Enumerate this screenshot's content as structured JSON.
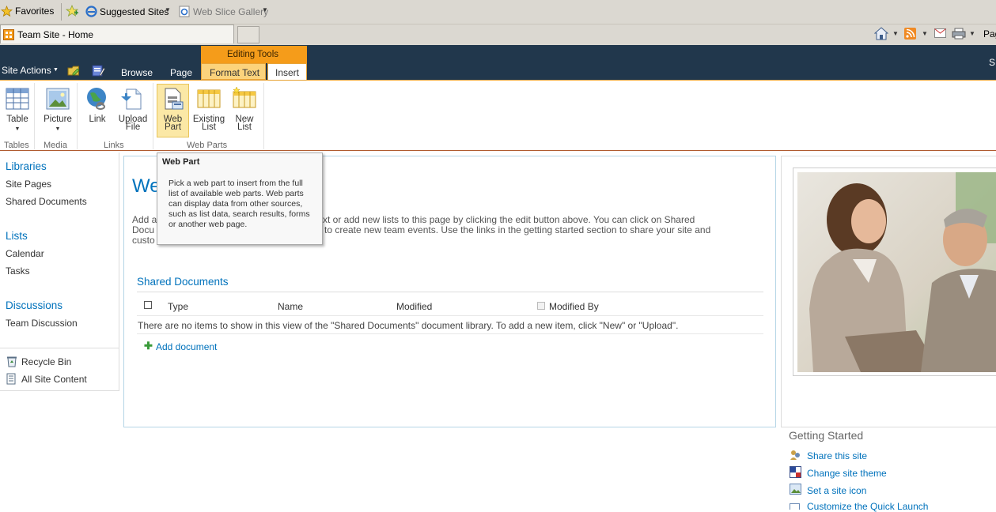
{
  "browser": {
    "favorites_label": "Favorites",
    "suggested_sites": "Suggested Sites",
    "web_slice_gallery": "Web Slice Gallery",
    "tab_title": "Team Site - Home",
    "page_menu": "Pag"
  },
  "sp_header": {
    "site_actions": "Site Actions",
    "tabs": [
      "Browse",
      "Page"
    ],
    "editing_tools": "Editing Tools",
    "format_text": "Format Text",
    "insert": "Insert",
    "right_letter": "S"
  },
  "ribbon": {
    "buttons": {
      "table": "Table",
      "picture": "Picture",
      "link": "Link",
      "upload_line1": "Upload",
      "upload_line2": "File",
      "webpart_line1": "Web",
      "webpart_line2": "Part",
      "existing_line1": "Existing",
      "existing_line2": "List",
      "new_line1": "New",
      "new_line2": "List"
    },
    "groups": [
      "Tables",
      "Media",
      "Links",
      "Web Parts"
    ]
  },
  "left_nav": {
    "libraries": "Libraries",
    "site_pages": "Site Pages",
    "shared_documents": "Shared Documents",
    "lists": "Lists",
    "calendar": "Calendar",
    "tasks": "Tasks",
    "discussions": "Discussions",
    "team_discussion": "Team Discussion",
    "recycle_bin": "Recycle Bin",
    "all_site_content": "All Site Content"
  },
  "main": {
    "title_partial": "We",
    "intro_line1_left": "Add a",
    "intro_line1_right": "xt or add new lists to this page by clicking the edit button above. You can click on Shared",
    "intro_line2_left": "Docu",
    "intro_line2_right": "to create new team events. Use the links in the getting started section to share your site and",
    "intro_line3_left": "custo",
    "shared_docs_title": "Shared Documents",
    "columns": [
      "Type",
      "Name",
      "Modified",
      "Modified By"
    ],
    "empty_message": "There are no items to show in this view of the \"Shared Documents\" document library. To add a new item, click \"New\" or \"Upload\".",
    "add_document": "Add document"
  },
  "tooltip": {
    "title": "Web Part",
    "body": "Pick a web part to insert from the full list of available web parts. Web parts can display data from other sources, such as list data, search results, forms or another web page."
  },
  "getting_started": {
    "title": "Getting Started",
    "links": [
      "Share this site",
      "Change site theme",
      "Set a site icon",
      "Customize the Quick Launch"
    ]
  },
  "colors": {
    "header_bg": "#21374c",
    "accent_orange": "#f59c1a",
    "link_blue": "#0072bc"
  }
}
